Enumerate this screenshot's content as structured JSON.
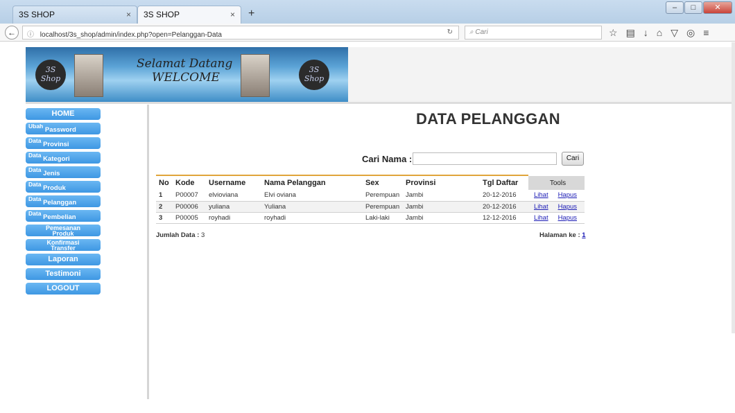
{
  "browser": {
    "tabs": [
      {
        "label": "3S SHOP"
      },
      {
        "label": "3S SHOP"
      }
    ],
    "url": "localhost/3s_shop/admin/index.php?open=Pelanggan-Data",
    "search_placeholder": "Cari"
  },
  "header": {
    "logo_left": "3S Shop",
    "welcome_line1": "Selamat Datang",
    "welcome_line2": "WELCOME",
    "logo_right": "3S Shop"
  },
  "sidebar": {
    "items": [
      {
        "label": "HOME"
      },
      {
        "small": "Ubah",
        "big": "Password"
      },
      {
        "small": "Data",
        "big": "Provinsi"
      },
      {
        "small": "Data",
        "big": "Kategori"
      },
      {
        "small": "Data",
        "big": "Jenis"
      },
      {
        "small": "Data",
        "big": "Produk"
      },
      {
        "small": "Data",
        "big": "Pelanggan"
      },
      {
        "small": "Data",
        "big": "Pembelian"
      },
      {
        "line1": "Pemesanan",
        "line2": "Produk"
      },
      {
        "line1": "Konfirmasi",
        "line2": "Transfer"
      },
      {
        "label": "Laporan"
      },
      {
        "label": "Testimoni"
      },
      {
        "label": "LOGOUT"
      }
    ]
  },
  "main": {
    "title": "DATA PELANGGAN",
    "search_label": "Cari Nama :",
    "search_button": "Cari",
    "columns": [
      "No",
      "Kode",
      "Username",
      "Nama Pelanggan",
      "Sex",
      "Provinsi",
      "Tgl Daftar",
      "Tools"
    ],
    "rows": [
      {
        "no": "1",
        "kode": "P00007",
        "username": "elvioviana",
        "nama": "Elvi oviana",
        "sex": "Perempuan",
        "provinsi": "Jambi",
        "tgl": "20-12-2016",
        "lihat": "Lihat",
        "hapus": "Hapus"
      },
      {
        "no": "2",
        "kode": "P00006",
        "username": "yuliana",
        "nama": "Yuliana",
        "sex": "Perempuan",
        "provinsi": "Jambi",
        "tgl": "20-12-2016",
        "lihat": "Lihat",
        "hapus": "Hapus"
      },
      {
        "no": "3",
        "kode": "P00005",
        "username": "royhadi",
        "nama": "royhadi",
        "sex": "Laki-laki",
        "provinsi": "Jambi",
        "tgl": "12-12-2016",
        "lihat": "Lihat",
        "hapus": "Hapus"
      }
    ],
    "jumlah_label": "Jumlah Data :",
    "jumlah_value": "3",
    "halaman_label": "Halaman ke :",
    "halaman_value": "1"
  }
}
